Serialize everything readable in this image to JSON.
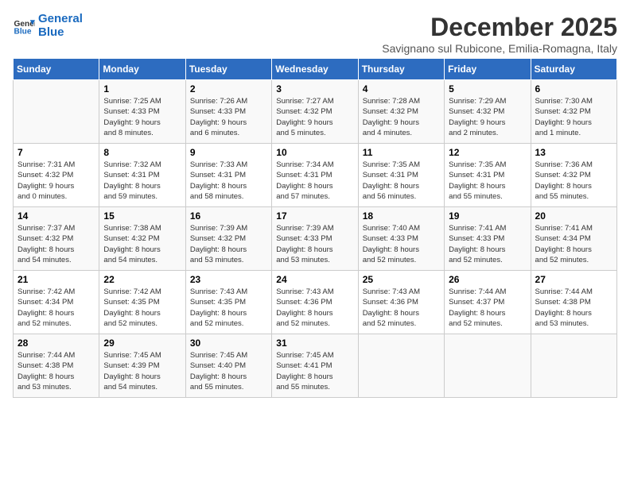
{
  "logo": {
    "line1": "General",
    "line2": "Blue"
  },
  "title": "December 2025",
  "subtitle": "Savignano sul Rubicone, Emilia-Romagna, Italy",
  "days_of_week": [
    "Sunday",
    "Monday",
    "Tuesday",
    "Wednesday",
    "Thursday",
    "Friday",
    "Saturday"
  ],
  "weeks": [
    [
      {
        "day": "",
        "info": ""
      },
      {
        "day": "1",
        "info": "Sunrise: 7:25 AM\nSunset: 4:33 PM\nDaylight: 9 hours\nand 8 minutes."
      },
      {
        "day": "2",
        "info": "Sunrise: 7:26 AM\nSunset: 4:33 PM\nDaylight: 9 hours\nand 6 minutes."
      },
      {
        "day": "3",
        "info": "Sunrise: 7:27 AM\nSunset: 4:32 PM\nDaylight: 9 hours\nand 5 minutes."
      },
      {
        "day": "4",
        "info": "Sunrise: 7:28 AM\nSunset: 4:32 PM\nDaylight: 9 hours\nand 4 minutes."
      },
      {
        "day": "5",
        "info": "Sunrise: 7:29 AM\nSunset: 4:32 PM\nDaylight: 9 hours\nand 2 minutes."
      },
      {
        "day": "6",
        "info": "Sunrise: 7:30 AM\nSunset: 4:32 PM\nDaylight: 9 hours\nand 1 minute."
      }
    ],
    [
      {
        "day": "7",
        "info": "Sunrise: 7:31 AM\nSunset: 4:32 PM\nDaylight: 9 hours\nand 0 minutes."
      },
      {
        "day": "8",
        "info": "Sunrise: 7:32 AM\nSunset: 4:31 PM\nDaylight: 8 hours\nand 59 minutes."
      },
      {
        "day": "9",
        "info": "Sunrise: 7:33 AM\nSunset: 4:31 PM\nDaylight: 8 hours\nand 58 minutes."
      },
      {
        "day": "10",
        "info": "Sunrise: 7:34 AM\nSunset: 4:31 PM\nDaylight: 8 hours\nand 57 minutes."
      },
      {
        "day": "11",
        "info": "Sunrise: 7:35 AM\nSunset: 4:31 PM\nDaylight: 8 hours\nand 56 minutes."
      },
      {
        "day": "12",
        "info": "Sunrise: 7:35 AM\nSunset: 4:31 PM\nDaylight: 8 hours\nand 55 minutes."
      },
      {
        "day": "13",
        "info": "Sunrise: 7:36 AM\nSunset: 4:32 PM\nDaylight: 8 hours\nand 55 minutes."
      }
    ],
    [
      {
        "day": "14",
        "info": "Sunrise: 7:37 AM\nSunset: 4:32 PM\nDaylight: 8 hours\nand 54 minutes."
      },
      {
        "day": "15",
        "info": "Sunrise: 7:38 AM\nSunset: 4:32 PM\nDaylight: 8 hours\nand 54 minutes."
      },
      {
        "day": "16",
        "info": "Sunrise: 7:39 AM\nSunset: 4:32 PM\nDaylight: 8 hours\nand 53 minutes."
      },
      {
        "day": "17",
        "info": "Sunrise: 7:39 AM\nSunset: 4:33 PM\nDaylight: 8 hours\nand 53 minutes."
      },
      {
        "day": "18",
        "info": "Sunrise: 7:40 AM\nSunset: 4:33 PM\nDaylight: 8 hours\nand 52 minutes."
      },
      {
        "day": "19",
        "info": "Sunrise: 7:41 AM\nSunset: 4:33 PM\nDaylight: 8 hours\nand 52 minutes."
      },
      {
        "day": "20",
        "info": "Sunrise: 7:41 AM\nSunset: 4:34 PM\nDaylight: 8 hours\nand 52 minutes."
      }
    ],
    [
      {
        "day": "21",
        "info": "Sunrise: 7:42 AM\nSunset: 4:34 PM\nDaylight: 8 hours\nand 52 minutes."
      },
      {
        "day": "22",
        "info": "Sunrise: 7:42 AM\nSunset: 4:35 PM\nDaylight: 8 hours\nand 52 minutes."
      },
      {
        "day": "23",
        "info": "Sunrise: 7:43 AM\nSunset: 4:35 PM\nDaylight: 8 hours\nand 52 minutes."
      },
      {
        "day": "24",
        "info": "Sunrise: 7:43 AM\nSunset: 4:36 PM\nDaylight: 8 hours\nand 52 minutes."
      },
      {
        "day": "25",
        "info": "Sunrise: 7:43 AM\nSunset: 4:36 PM\nDaylight: 8 hours\nand 52 minutes."
      },
      {
        "day": "26",
        "info": "Sunrise: 7:44 AM\nSunset: 4:37 PM\nDaylight: 8 hours\nand 52 minutes."
      },
      {
        "day": "27",
        "info": "Sunrise: 7:44 AM\nSunset: 4:38 PM\nDaylight: 8 hours\nand 53 minutes."
      }
    ],
    [
      {
        "day": "28",
        "info": "Sunrise: 7:44 AM\nSunset: 4:38 PM\nDaylight: 8 hours\nand 53 minutes."
      },
      {
        "day": "29",
        "info": "Sunrise: 7:45 AM\nSunset: 4:39 PM\nDaylight: 8 hours\nand 54 minutes."
      },
      {
        "day": "30",
        "info": "Sunrise: 7:45 AM\nSunset: 4:40 PM\nDaylight: 8 hours\nand 55 minutes."
      },
      {
        "day": "31",
        "info": "Sunrise: 7:45 AM\nSunset: 4:41 PM\nDaylight: 8 hours\nand 55 minutes."
      },
      {
        "day": "",
        "info": ""
      },
      {
        "day": "",
        "info": ""
      },
      {
        "day": "",
        "info": ""
      }
    ]
  ]
}
